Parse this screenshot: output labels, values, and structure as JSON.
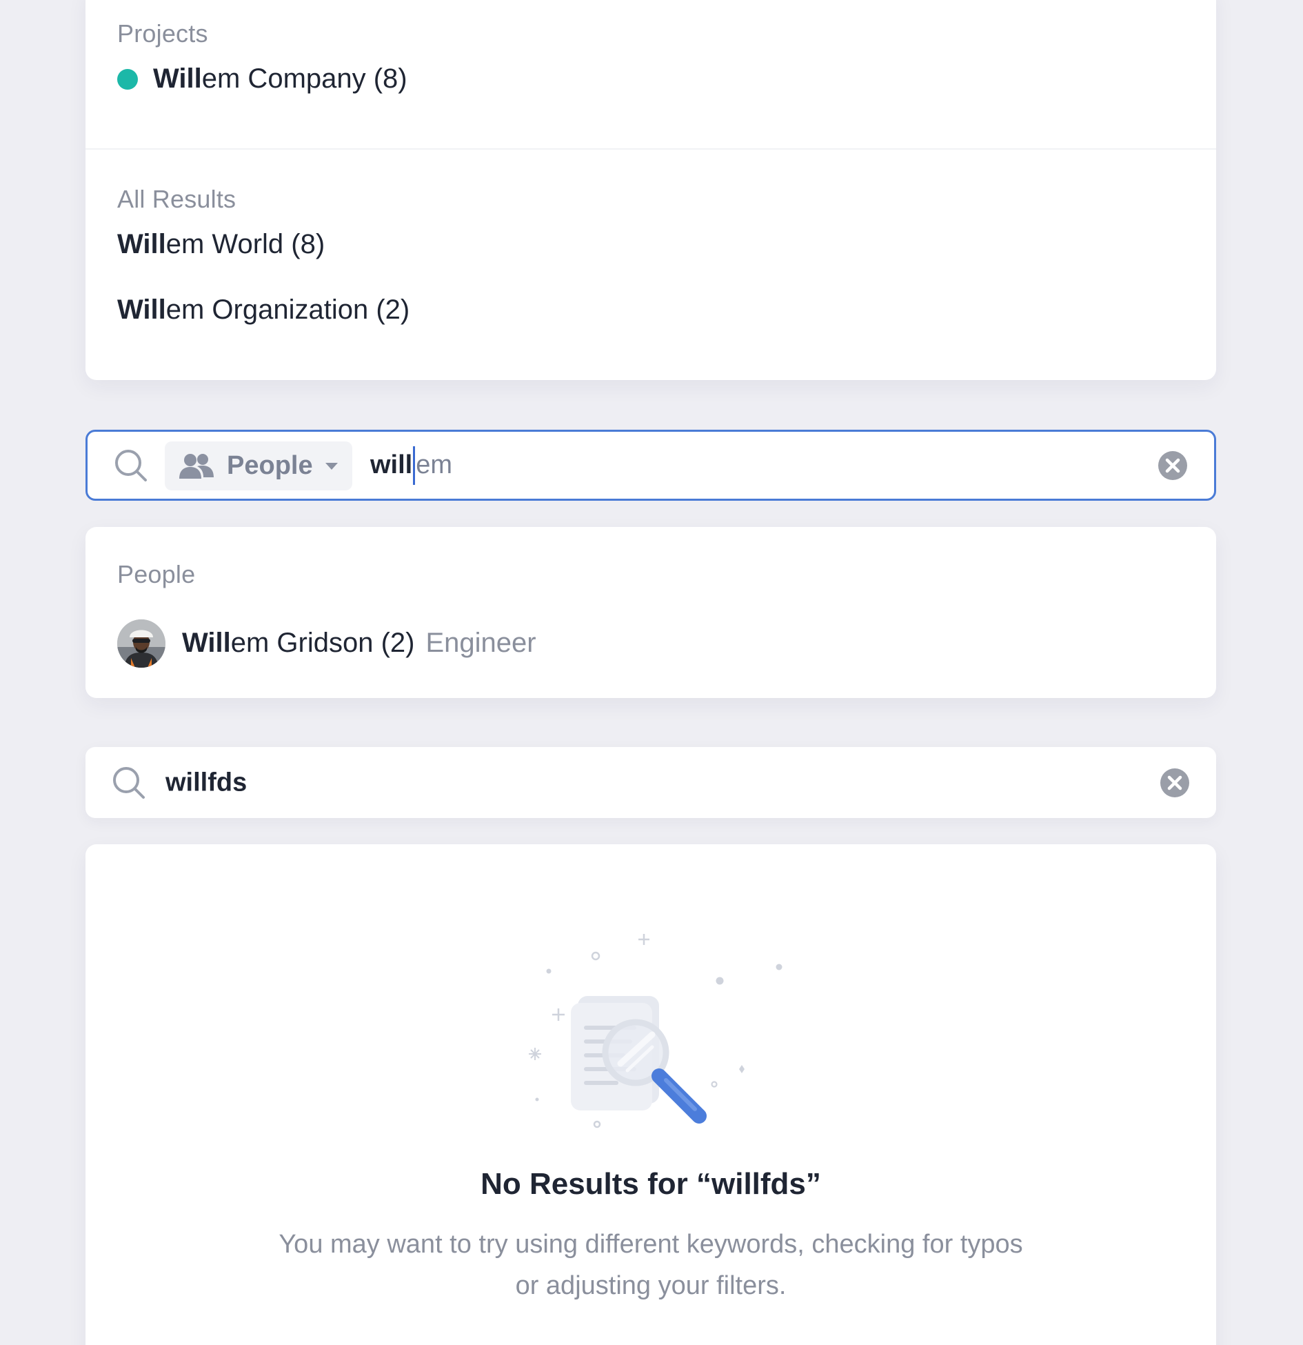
{
  "results_card": {
    "projects_label": "Projects",
    "project_item": {
      "highlight": "Will",
      "rest": "em Company (8)",
      "dot_color": "#1cb8a8"
    },
    "all_results_label": "All Results",
    "all_results": [
      {
        "highlight": "Will",
        "rest": "em World (8)"
      },
      {
        "highlight": "Will",
        "rest": "em Organization (2)"
      }
    ]
  },
  "search_active": {
    "filter_label": "People",
    "typed": "will",
    "suggestion": "em",
    "accent": "#4a7bd6"
  },
  "people_card": {
    "label": "People",
    "person": {
      "highlight": "Will",
      "rest": "em Gridson (2)",
      "role": "Engineer"
    }
  },
  "search_plain": {
    "value": "willfds"
  },
  "empty_state": {
    "title": "No Results for “willfds”",
    "description": "You may want to try using different keywords, checking for typos or adjusting your filters."
  }
}
